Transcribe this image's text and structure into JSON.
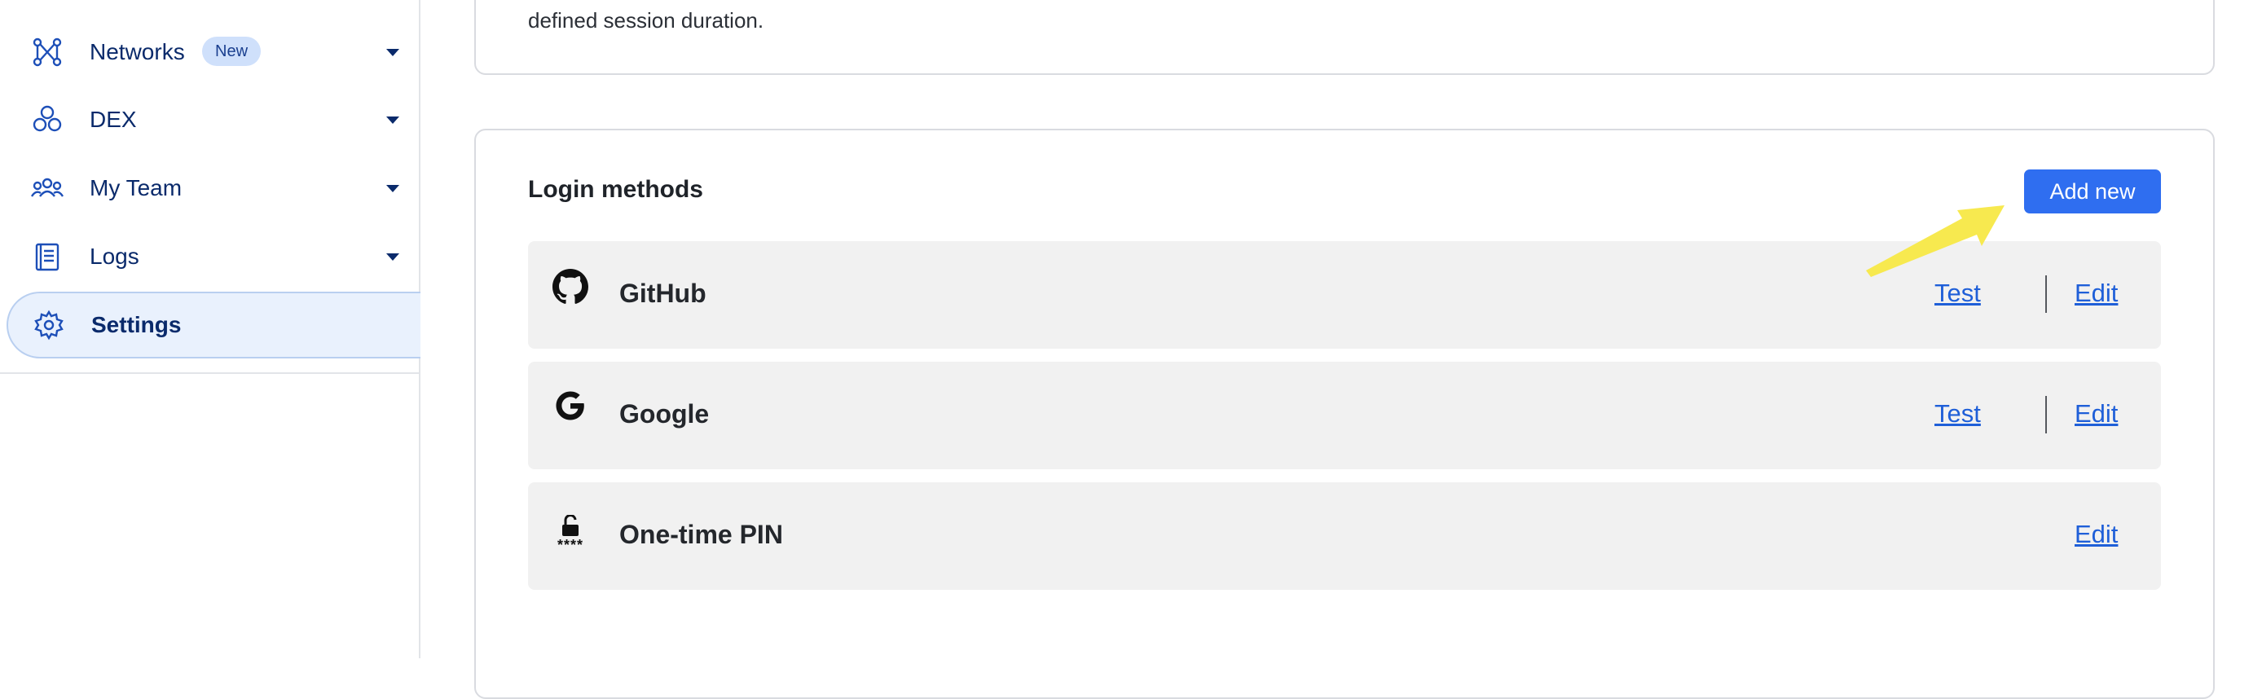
{
  "sidebar": {
    "items": [
      {
        "label": "Networks",
        "badge": "New",
        "icon": "network-icon"
      },
      {
        "label": "DEX",
        "icon": "dex-icon"
      },
      {
        "label": "My Team",
        "icon": "team-icon"
      },
      {
        "label": "Logs",
        "icon": "logs-icon"
      },
      {
        "label": "Settings",
        "icon": "gear-icon",
        "active": true
      }
    ]
  },
  "top_card": {
    "text": "defined session duration."
  },
  "login_methods": {
    "title": "Login methods",
    "add_button": "Add new",
    "methods": [
      {
        "name": "GitHub",
        "icon": "github-icon",
        "test_label": "Test",
        "edit_label": "Edit"
      },
      {
        "name": "Google",
        "icon": "google-icon",
        "test_label": "Test",
        "edit_label": "Edit"
      },
      {
        "name": "One-time PIN",
        "icon": "pin-lock-icon",
        "edit_label": "Edit",
        "pin_mask": "****"
      }
    ]
  },
  "colors": {
    "accent": "#2f6ef0",
    "link": "#1f5fd8",
    "nav": "#0a2a6b",
    "annotation_arrow": "#f7e94f"
  }
}
